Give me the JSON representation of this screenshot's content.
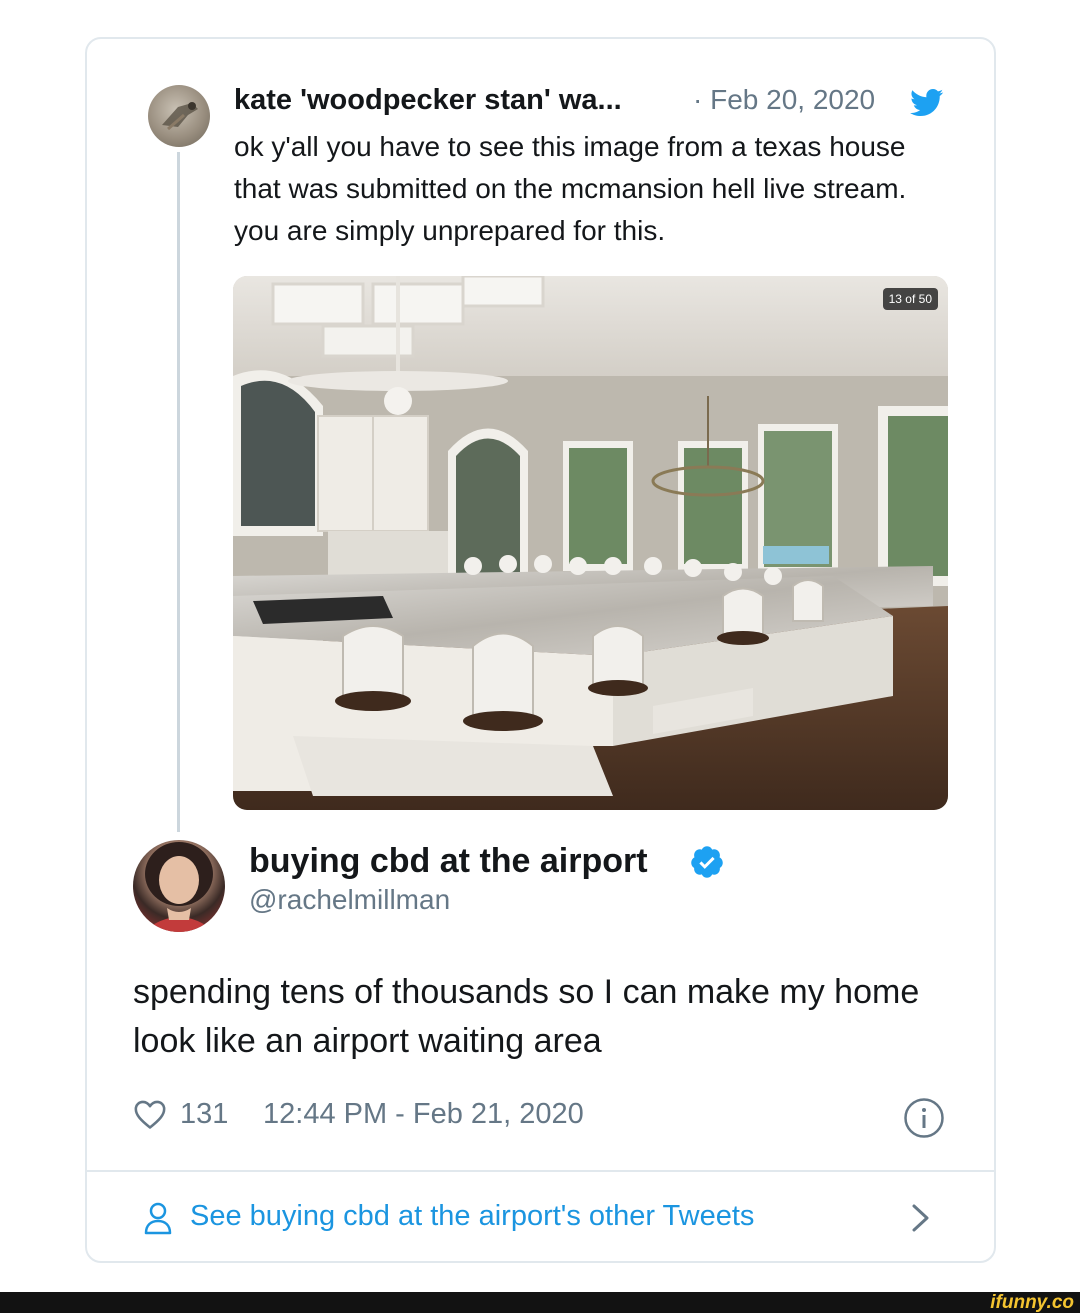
{
  "quoted_tweet": {
    "author_name": "kate 'woodpecker stan' wa...",
    "date": "· Feb 20, 2020",
    "text": "ok y'all you have to see this image from a texas house that was submitted on the mcmansion hell live stream. you are simply unprepared for this.",
    "photo_badge": "13 of 50",
    "photo_icon": "kitchen-photo"
  },
  "tweet": {
    "author_name": "buying cbd at the airport",
    "author_handle": "@rachelmillman",
    "verified": true,
    "text": "spending tens of thousands so I can make my home look like an airport waiting area",
    "like_count": "131",
    "timestamp": "12:44 PM - Feb 21, 2020"
  },
  "footer": {
    "see_more_label": "See buying cbd at the airport's other Tweets"
  },
  "watermark": "ifunny.co",
  "colors": {
    "accent": "#1b95e0",
    "secondary_text": "#657786",
    "border": "#e1e8ed"
  }
}
